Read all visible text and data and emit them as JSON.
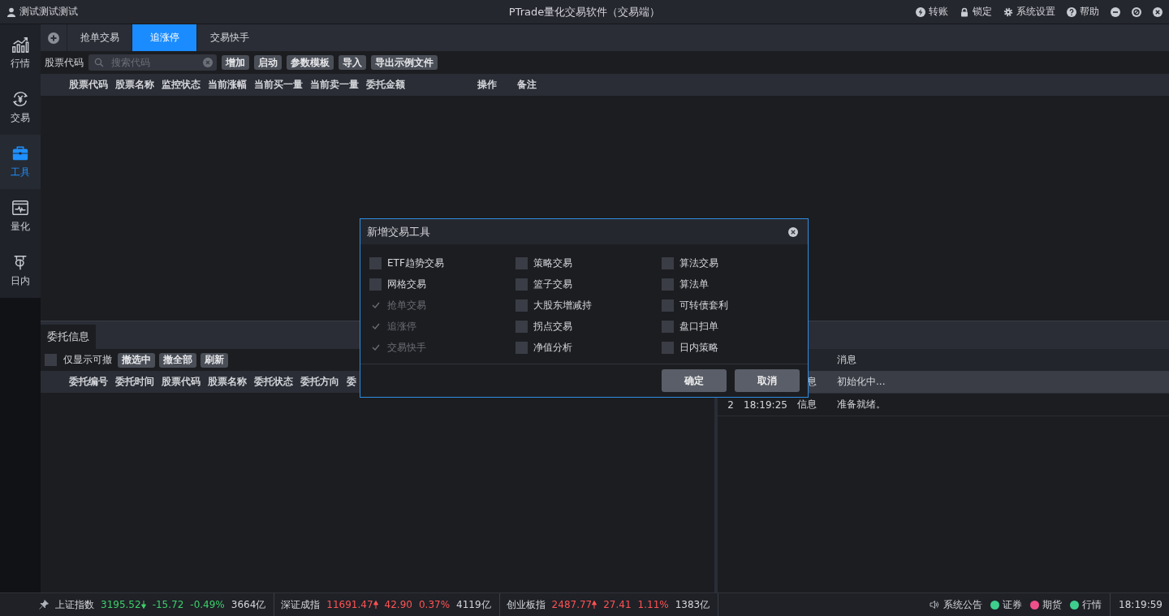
{
  "window": {
    "user": "测试测试测试",
    "title": "PTrade量化交易软件（交易端）",
    "actions": [
      {
        "kind": "transfer",
        "label": "转账"
      },
      {
        "kind": "lock",
        "label": "锁定"
      },
      {
        "kind": "settings",
        "label": "系统设置"
      },
      {
        "kind": "help",
        "label": "帮助"
      }
    ]
  },
  "sidebar": {
    "items": [
      {
        "kind": "chart",
        "label": "行情",
        "selected": false
      },
      {
        "kind": "yen",
        "label": "交易",
        "selected": false
      },
      {
        "kind": "toolbox",
        "label": "工具",
        "selected": true
      },
      {
        "kind": "monitor",
        "label": "量化",
        "selected": false
      },
      {
        "kind": "intraday",
        "label": "日内",
        "selected": false
      }
    ]
  },
  "tabs": [
    {
      "label": "抢单交易",
      "selected": false
    },
    {
      "label": "追涨停",
      "selected": true
    },
    {
      "label": "交易快手",
      "selected": false
    }
  ],
  "toolbar": {
    "label": "股票代码",
    "search": {
      "placeholder": "搜索代码"
    },
    "buttons": [
      "增加",
      "启动",
      "参数模板",
      "导入",
      "导出示例文件"
    ]
  },
  "table": {
    "columns": [
      "股票代码",
      "股票名称",
      "监控状态",
      "当前涨幅",
      "当前买一量",
      "当前卖一量",
      "委托金额",
      "操作",
      "备注"
    ]
  },
  "orders": {
    "tab": "委托信息",
    "filter": {
      "label": "仅显示可撤",
      "checked": false
    },
    "buttons": [
      "撤选中",
      "撤全部",
      "刷新"
    ],
    "columns": [
      "委托编号",
      "委托时间",
      "股票代码",
      "股票名称",
      "委托状态",
      "委托方向",
      "委"
    ]
  },
  "log": {
    "columns": [
      "消息"
    ],
    "rows": [
      {
        "index": "",
        "time": "",
        "type": "息",
        "message": "初始化中...",
        "selected": true
      },
      {
        "index": "2",
        "time": "18:19:25",
        "type": "信息",
        "message": "准备就绪。",
        "selected": false
      }
    ]
  },
  "dialog": {
    "title": "新增交易工具",
    "options": [
      {
        "label": "ETF趋势交易",
        "checked": false,
        "disabled": false
      },
      {
        "label": "策略交易",
        "checked": false,
        "disabled": false
      },
      {
        "label": "算法交易",
        "checked": false,
        "disabled": false
      },
      {
        "label": "网格交易",
        "checked": false,
        "disabled": false
      },
      {
        "label": "篮子交易",
        "checked": false,
        "disabled": false
      },
      {
        "label": "算法单",
        "checked": false,
        "disabled": false
      },
      {
        "label": "抢单交易",
        "checked": true,
        "disabled": true
      },
      {
        "label": "大股东增减持",
        "checked": false,
        "disabled": false
      },
      {
        "label": "可转债套利",
        "checked": false,
        "disabled": false
      },
      {
        "label": "追涨停",
        "checked": true,
        "disabled": true
      },
      {
        "label": "拐点交易",
        "checked": false,
        "disabled": false
      },
      {
        "label": "盘口扫单",
        "checked": false,
        "disabled": false
      },
      {
        "label": "交易快手",
        "checked": true,
        "disabled": true
      },
      {
        "label": "净值分析",
        "checked": false,
        "disabled": false
      },
      {
        "label": "日内策略",
        "checked": false,
        "disabled": false
      }
    ],
    "buttons": [
      "确定",
      "取消"
    ]
  },
  "status_bar": {
    "indices": [
      {
        "name": "上证指数",
        "price": "3195.52",
        "rising": false,
        "change": "-15.72",
        "percent": "-0.49%",
        "volume": "3664亿"
      },
      {
        "name": "深证成指",
        "price": "11691.47",
        "rising": true,
        "change": "42.90",
        "percent": "0.37%",
        "volume": "4119亿"
      },
      {
        "name": "创业板指",
        "price": "2487.77",
        "rising": true,
        "change": "27.41",
        "percent": "1.11%",
        "volume": "1383亿"
      }
    ],
    "notice": "系统公告",
    "connections": [
      {
        "label": "证券",
        "color": "#3ecf8e"
      },
      {
        "label": "期货",
        "color": "#f0508a"
      },
      {
        "label": "行情",
        "color": "#3ecf8e"
      }
    ],
    "time": "18:19:59"
  }
}
